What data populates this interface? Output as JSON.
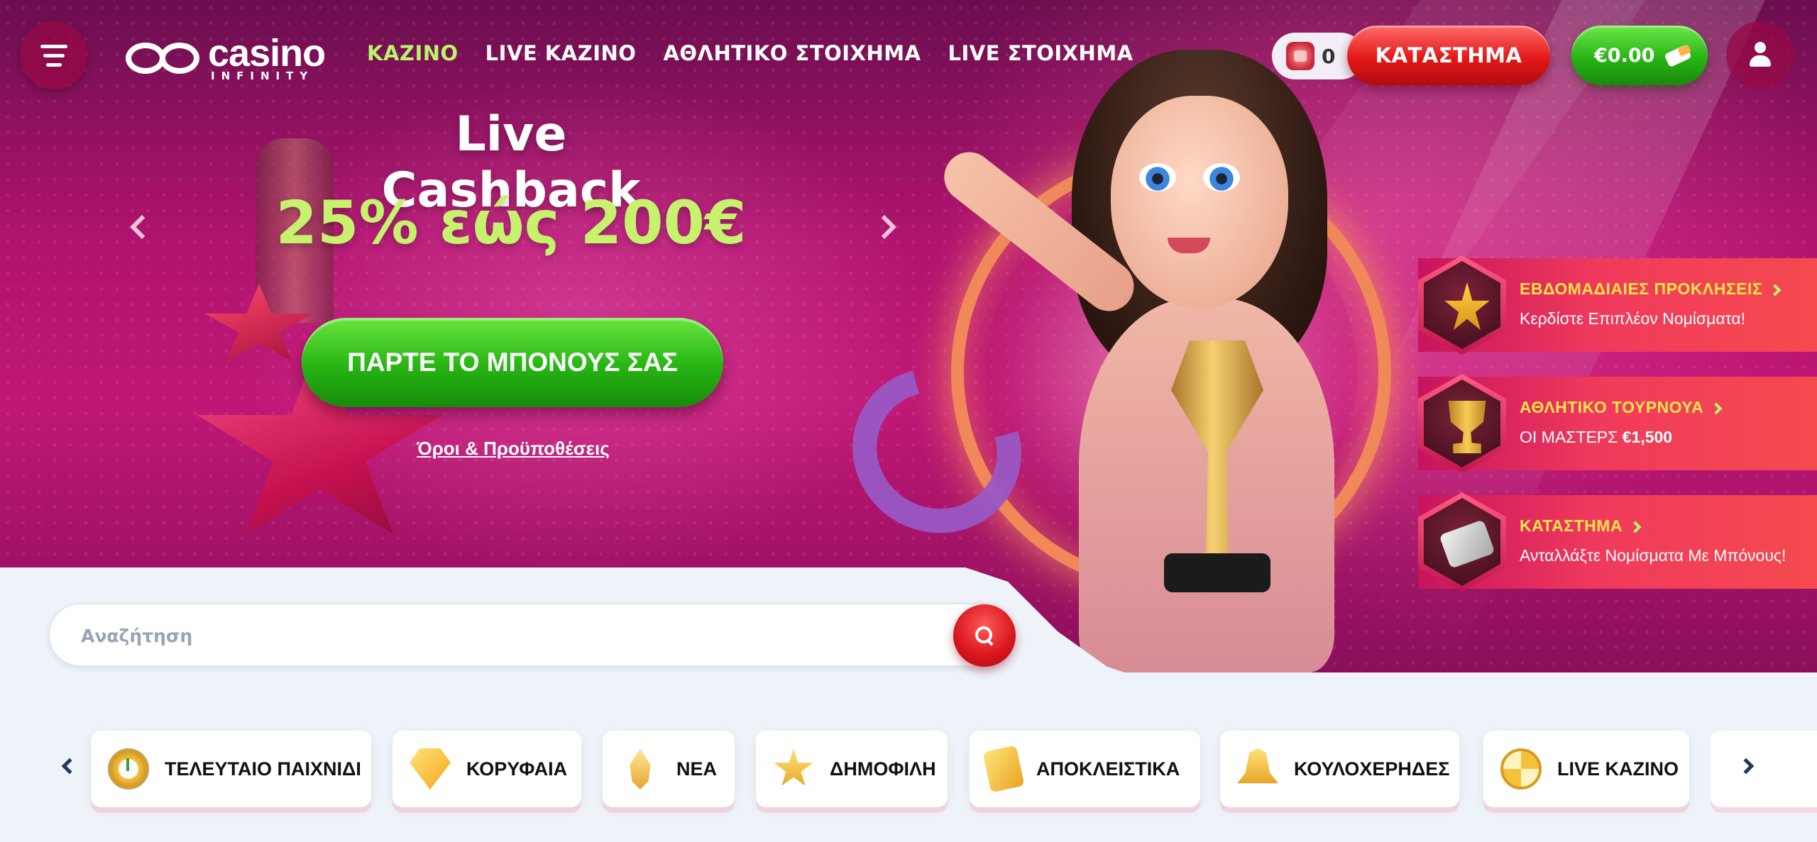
{
  "brand": {
    "name": "casino",
    "sub": "INFINITY"
  },
  "nav": [
    {
      "label": "ΚΑΖΙΝΟ",
      "active": true
    },
    {
      "label": "LIVE ΚΑΖΙΝΟ",
      "active": false
    },
    {
      "label": "ΑΘΛΗΤΙΚΟ ΣΤΟΙΧΗΜΑ",
      "active": false
    },
    {
      "label": "LIVE ΣΤΟΙΧΗΜΑ",
      "active": false
    }
  ],
  "header": {
    "coins": "0",
    "store_label": "ΚΑΤΑΣΤΗΜΑ",
    "balance": "€0.00"
  },
  "hero": {
    "title": "Live Cashback",
    "amount": "25% εώς 200€",
    "cta_label": "ΠΑΡΤΕ ΤΟ ΜΠΟΝΟΥΣ ΣΑΣ",
    "terms_label": "Όροι & Προϋποθέσεις"
  },
  "side_promos": [
    {
      "title": "ΕΒΔΟΜΑΔΙΑΙΕΣ ΠΡΟΚΛΗΣΕΙΣ",
      "subtitle": "Κερδίστε Επιπλέον Νομίσματα!",
      "icon": "star-anvil-icon"
    },
    {
      "title": "ΑΘΛΗΤΙΚΟ ΤΟΥΡΝΟΥΑ",
      "subtitle_prefix": "ΟΙ ΜΑΣΤΕΡΣ ",
      "subtitle_amount": "€1,500",
      "icon": "trophy-icon"
    },
    {
      "title": "ΚΑΤΑΣΤΗΜΑ",
      "subtitle": "Ανταλλάξτε Νομίσματα Με Μπόνους!",
      "icon": "card-icon"
    }
  ],
  "search": {
    "placeholder": "Αναζήτηση",
    "value": ""
  },
  "categories": [
    {
      "label": "ΤΕΛΕΥΤΑΙΟ ΠΑΙΧΝΙΔΙ",
      "icon": "clock-icon"
    },
    {
      "label": "ΚΟΡΥΦΑΙΑ",
      "icon": "gem-icon"
    },
    {
      "label": "ΝΕΑ",
      "icon": "flame-icon"
    },
    {
      "label": "ΔΗΜΟΦΙΛΗ",
      "icon": "star-icon"
    },
    {
      "label": "ΑΠΟΚΛΕΙΣΤΙΚΑ",
      "icon": "ticket-icon"
    },
    {
      "label": "ΚΟΥΛΟΧΕΡΗΔΕΣ",
      "icon": "bell-icon"
    },
    {
      "label": "LIVE ΚΑΖΙΝΟ",
      "icon": "chip-icon"
    }
  ],
  "colors": {
    "nav_active": "#b8f56a",
    "store_red": "#e31818",
    "balance_green": "#28b415",
    "hero_magenta": "#c01776",
    "promo_amount": "#c6f26e"
  }
}
